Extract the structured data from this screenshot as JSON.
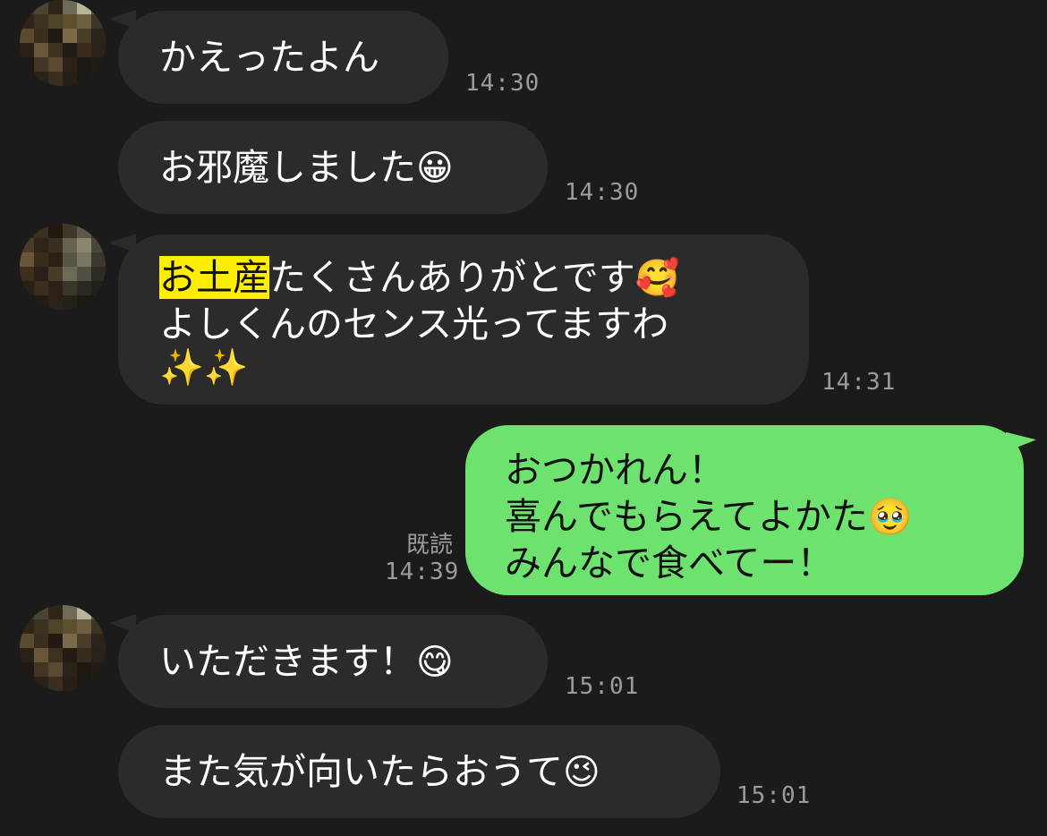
{
  "messages": [
    {
      "text": "かえったよん",
      "time": "14:30"
    },
    {
      "text": "お邪魔しました",
      "emoji": "😀",
      "time": "14:30"
    },
    {
      "highlight": "お土産",
      "line1_rest": "たくさんありがとです",
      "line1_emoji": "🥰",
      "line2": "よしくんのセンス光ってますわ",
      "line3_emoji": "✨✨",
      "time": "14:31"
    },
    {
      "line1": "おつかれん！",
      "line2": "喜んでもらえてよかた",
      "line2_emoji": "🥹",
      "line3": "みんなで食べてー！",
      "read": "既読",
      "time": "14:39"
    },
    {
      "text": "いただきます！",
      "emoji": "😋",
      "time": "15:01"
    },
    {
      "text": "また気が向いたらおうて",
      "emoji": "😉",
      "time": "15:01"
    }
  ]
}
